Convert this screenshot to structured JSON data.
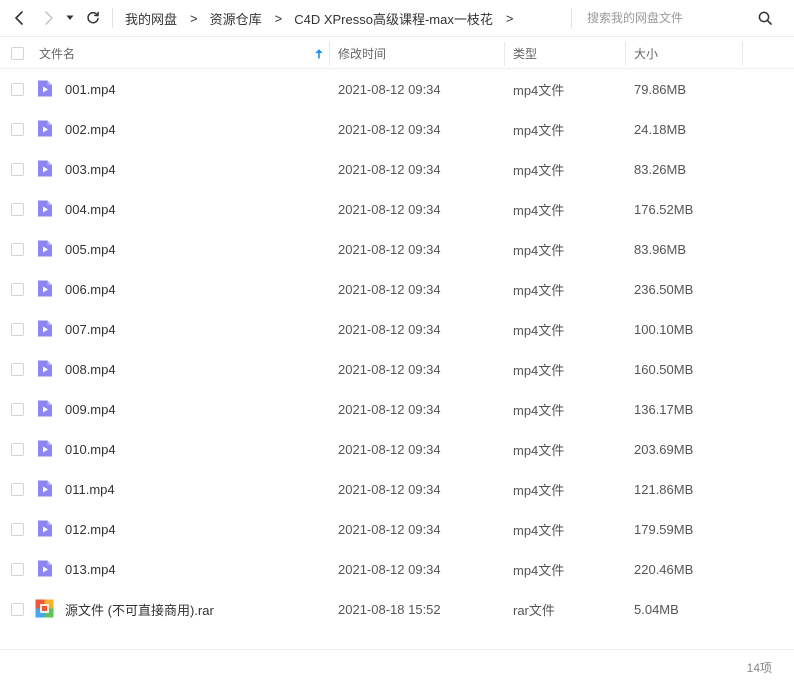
{
  "toolbar": {
    "breadcrumb": [
      "我的网盘",
      "资源仓库",
      "C4D XPresso高级课程-max一枝花"
    ],
    "breadcrumb_separator": ">",
    "search_placeholder": "搜索我的网盘文件"
  },
  "columns": {
    "name": "文件名",
    "modified": "修改时间",
    "type": "类型",
    "size": "大小",
    "sort": "name-ascending"
  },
  "files": [
    {
      "name": "001.mp4",
      "modified": "2021-08-12 09:34",
      "type": "mp4文件",
      "size": "79.86MB",
      "icon": "video-file-icon"
    },
    {
      "name": "002.mp4",
      "modified": "2021-08-12 09:34",
      "type": "mp4文件",
      "size": "24.18MB",
      "icon": "video-file-icon"
    },
    {
      "name": "003.mp4",
      "modified": "2021-08-12 09:34",
      "type": "mp4文件",
      "size": "83.26MB",
      "icon": "video-file-icon"
    },
    {
      "name": "004.mp4",
      "modified": "2021-08-12 09:34",
      "type": "mp4文件",
      "size": "176.52MB",
      "icon": "video-file-icon"
    },
    {
      "name": "005.mp4",
      "modified": "2021-08-12 09:34",
      "type": "mp4文件",
      "size": "83.96MB",
      "icon": "video-file-icon"
    },
    {
      "name": "006.mp4",
      "modified": "2021-08-12 09:34",
      "type": "mp4文件",
      "size": "236.50MB",
      "icon": "video-file-icon"
    },
    {
      "name": "007.mp4",
      "modified": "2021-08-12 09:34",
      "type": "mp4文件",
      "size": "100.10MB",
      "icon": "video-file-icon"
    },
    {
      "name": "008.mp4",
      "modified": "2021-08-12 09:34",
      "type": "mp4文件",
      "size": "160.50MB",
      "icon": "video-file-icon"
    },
    {
      "name": "009.mp4",
      "modified": "2021-08-12 09:34",
      "type": "mp4文件",
      "size": "136.17MB",
      "icon": "video-file-icon"
    },
    {
      "name": "010.mp4",
      "modified": "2021-08-12 09:34",
      "type": "mp4文件",
      "size": "203.69MB",
      "icon": "video-file-icon"
    },
    {
      "name": "011.mp4",
      "modified": "2021-08-12 09:34",
      "type": "mp4文件",
      "size": "121.86MB",
      "icon": "video-file-icon"
    },
    {
      "name": "012.mp4",
      "modified": "2021-08-12 09:34",
      "type": "mp4文件",
      "size": "179.59MB",
      "icon": "video-file-icon"
    },
    {
      "name": "013.mp4",
      "modified": "2021-08-12 09:34",
      "type": "mp4文件",
      "size": "220.46MB",
      "icon": "video-file-icon"
    },
    {
      "name": "源文件 (不可直接商用).rar",
      "modified": "2021-08-18 15:52",
      "type": "rar文件",
      "size": "5.04MB",
      "icon": "archive-file-icon"
    }
  ],
  "footer": {
    "item_count": "14项"
  },
  "colors": {
    "video_icon": "#8b86f4",
    "sort_arrow": "#1e90e6",
    "archive_icon": [
      "#f0563a",
      "#f5b32c",
      "#47a6f2",
      "#5fc35b"
    ]
  }
}
